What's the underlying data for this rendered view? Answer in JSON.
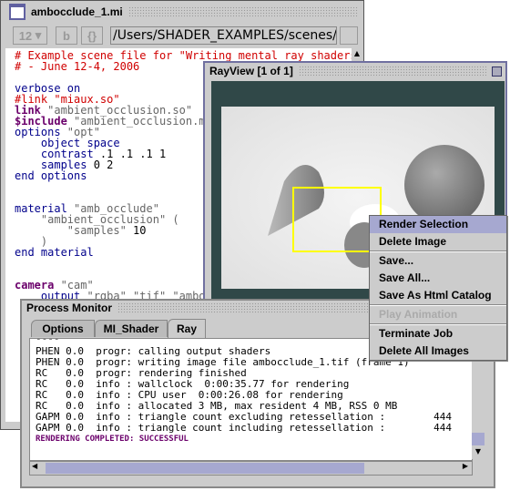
{
  "editor": {
    "title": "ambocclude_1.mi",
    "font_size": "12",
    "bold_label": "b",
    "braces_label": "{}",
    "path": "/Users/SHADER_EXAMPLES/scenes/am",
    "lines": [
      [
        {
          "t": "# Example scene file for \"Writing mental ray shaders",
          "c": "cm"
        }
      ],
      [
        {
          "t": "# - June 12-4, 2006",
          "c": "cm"
        }
      ],
      [],
      [
        {
          "t": "verbose on",
          "c": "kw"
        }
      ],
      [
        {
          "t": "#link \"miaux.so\"",
          "c": "cm"
        }
      ],
      [
        {
          "t": "link",
          "c": "bk"
        },
        {
          "t": " \"ambient_occlusion.so\"",
          "c": "st"
        }
      ],
      [
        {
          "t": "$include",
          "c": "bk"
        },
        {
          "t": " \"ambient_occlusion.mi",
          "c": "st"
        }
      ],
      [
        {
          "t": "options",
          "c": "kw"
        },
        {
          "t": " \"opt\"",
          "c": "st"
        }
      ],
      [
        {
          "t": "    object space",
          "c": "kw"
        }
      ],
      [
        {
          "t": "    contrast",
          "c": "kw"
        },
        {
          "t": " .1 .1 .1 1",
          "c": "nm"
        }
      ],
      [
        {
          "t": "    samples",
          "c": "kw"
        },
        {
          "t": " 0 2",
          "c": "nm"
        }
      ],
      [
        {
          "t": "end options",
          "c": "kw"
        }
      ],
      [],
      [],
      [
        {
          "t": "material",
          "c": "kw"
        },
        {
          "t": " \"amb_occlude\"",
          "c": "st"
        }
      ],
      [
        {
          "t": "    \"ambient_occlusion\" (",
          "c": "st"
        }
      ],
      [
        {
          "t": "        \"samples\"",
          "c": "st"
        },
        {
          "t": " 10",
          "c": "nm"
        }
      ],
      [
        {
          "t": "    )",
          "c": "st"
        }
      ],
      [
        {
          "t": "end material",
          "c": "kw"
        }
      ],
      [],
      [],
      [
        {
          "t": "camera",
          "c": "bk"
        },
        {
          "t": " \"cam\"",
          "c": "st"
        }
      ],
      [
        {
          "t": "    output",
          "c": "kw"
        },
        {
          "t": " \"rgba\" \"tif\" \"ambocc",
          "c": "st"
        }
      ]
    ]
  },
  "rayview": {
    "title": "RayView [1 of 1]"
  },
  "context_menu": {
    "items": [
      "Render Selection",
      "Delete Image",
      "Save...",
      "Save All...",
      "Save As Html Catalog",
      "Play Animation",
      "Terminate Job",
      "Delete All Images"
    ],
    "highlighted": "Render Selection",
    "disabled": "Play Animation"
  },
  "process_monitor": {
    "title": "Process Monitor",
    "tabs": [
      "Options",
      "MI_Shader",
      "Ray"
    ],
    "active_tab": "Ray",
    "log": [
      "PHEN 0.0  progr: calling output shaders",
      "PHEN 0.0  progr: writing image file ambocclude_1.tif (frame 1)",
      "RC   0.0  progr: rendering finished",
      "RC   0.0  info : wallclock  0:00:35.77 for rendering",
      "RC   0.0  info : CPU user  0:00:26.08 for rendering",
      "RC   0.0  info : allocated 3 MB, max resident 4 MB, RSS 0 MB",
      "GAPM 0.0  info : triangle count excluding retessellation :        444",
      "GAPM 0.0  info : triangle count including retessellation :        444"
    ],
    "status": "RENDERING COMPLETED: SUCCESSFUL"
  },
  "colors": {
    "selection": "#ffff00",
    "menu_highlight": "#a6a8d0",
    "window_frame": "#7070a0",
    "status": "#6b006b"
  }
}
